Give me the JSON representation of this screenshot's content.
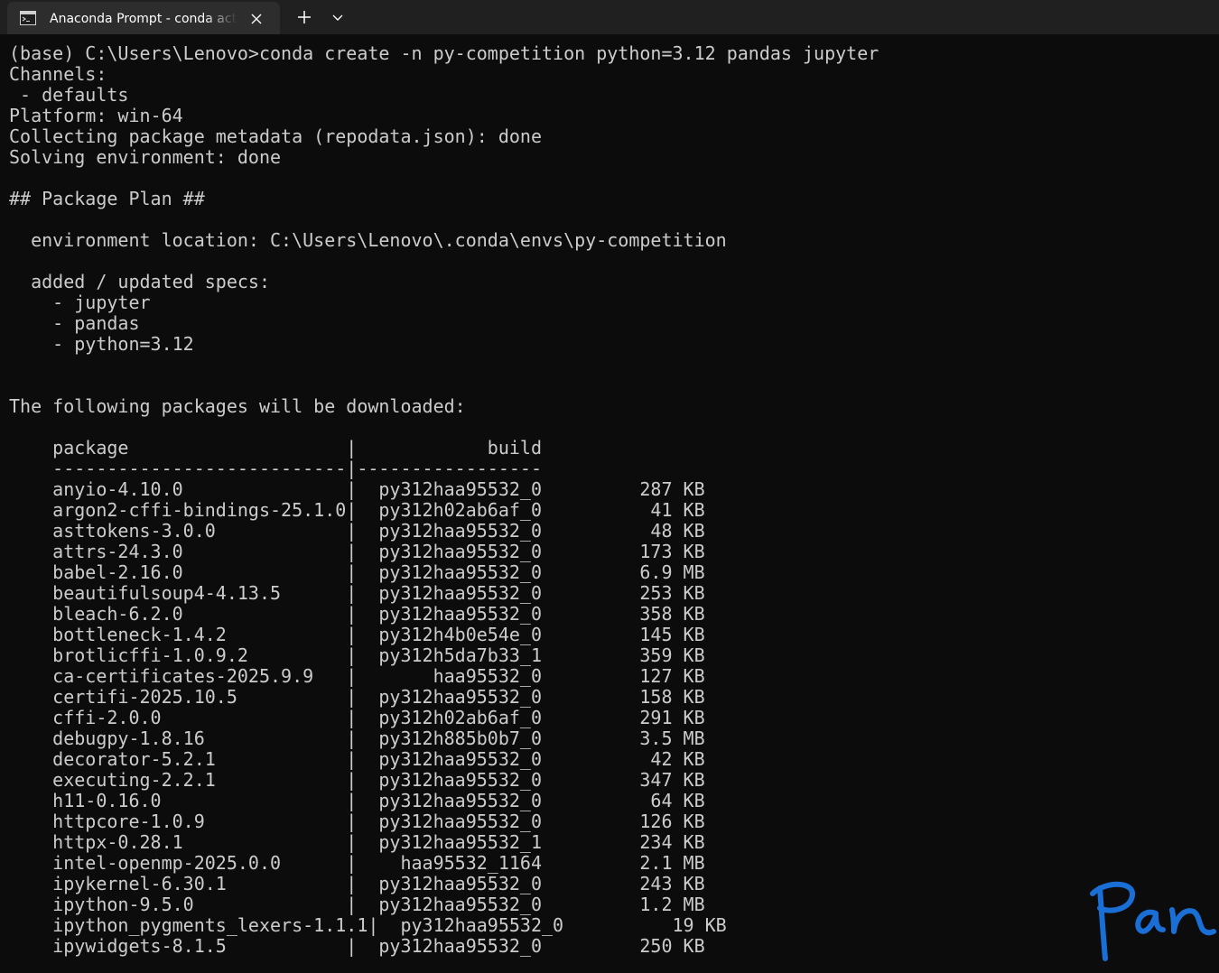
{
  "tab": {
    "title": "Anaconda Prompt - conda  activate base",
    "icon": "terminal-icon",
    "close_icon": "close-icon"
  },
  "titlebar": {
    "new_tab_icon": "plus-icon",
    "dropdown_icon": "chevron-down-icon"
  },
  "terminal": {
    "lines": [
      "(base) C:\\Users\\Lenovo>conda create -n py-competition python=3.12 pandas jupyter",
      "Channels:",
      " - defaults",
      "Platform: win-64",
      "Collecting package metadata (repodata.json): done",
      "Solving environment: done",
      "",
      "## Package Plan ##",
      "",
      "  environment location: C:\\Users\\Lenovo\\.conda\\envs\\py-competition",
      "",
      "  added / updated specs:",
      "    - jupyter",
      "    - pandas",
      "    - python=3.12",
      "",
      "",
      "The following packages will be downloaded:",
      "",
      "    package                    |            build",
      "    ---------------------------|-----------------",
      "    anyio-4.10.0               |  py312haa95532_0         287 KB",
      "    argon2-cffi-bindings-25.1.0|  py312h02ab6af_0          41 KB",
      "    asttokens-3.0.0            |  py312haa95532_0          48 KB",
      "    attrs-24.3.0               |  py312haa95532_0         173 KB",
      "    babel-2.16.0               |  py312haa95532_0         6.9 MB",
      "    beautifulsoup4-4.13.5      |  py312haa95532_0         253 KB",
      "    bleach-6.2.0               |  py312haa95532_0         358 KB",
      "    bottleneck-1.4.2           |  py312h4b0e54e_0         145 KB",
      "    brotlicffi-1.0.9.2         |  py312h5da7b33_1         359 KB",
      "    ca-certificates-2025.9.9   |       haa95532_0         127 KB",
      "    certifi-2025.10.5          |  py312haa95532_0         158 KB",
      "    cffi-2.0.0                 |  py312h02ab6af_0         291 KB",
      "    debugpy-1.8.16             |  py312h885b0b7_0         3.5 MB",
      "    decorator-5.2.1            |  py312haa95532_0          42 KB",
      "    executing-2.2.1            |  py312haa95532_0         347 KB",
      "    h11-0.16.0                 |  py312haa95532_0          64 KB",
      "    httpcore-1.0.9             |  py312haa95532_0         126 KB",
      "    httpx-0.28.1               |  py312haa95532_1         234 KB",
      "    intel-openmp-2025.0.0      |    haa95532_1164         2.1 MB",
      "    ipykernel-6.30.1           |  py312haa95532_0         243 KB",
      "    ipython-9.5.0              |  py312haa95532_0         1.2 MB",
      "    ipython_pygments_lexers-1.1.1|  py312haa95532_0          19 KB",
      "    ipywidgets-8.1.5           |  py312haa95532_0         250 KB"
    ]
  },
  "signature": {
    "text": "Pan",
    "color": "#1a6fd6"
  },
  "colors": {
    "terminal_bg": "#0c0c0c",
    "terminal_fg": "#cccccc",
    "titlebar_bg": "#202020",
    "active_tab_bg": "#2d2d2d"
  }
}
